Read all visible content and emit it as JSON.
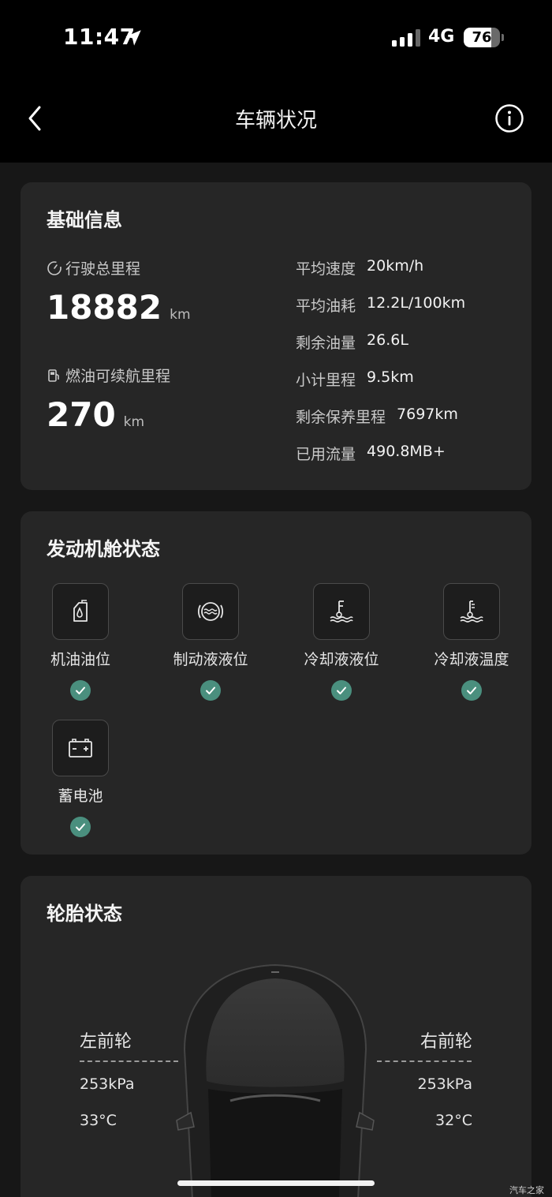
{
  "status": {
    "time": "11:47",
    "network": "4G",
    "battery": "76",
    "battery_level": 0.76
  },
  "nav": {
    "title": "车辆状况"
  },
  "basic": {
    "title": "基础信息",
    "total_mileage_label": "行驶总里程",
    "total_mileage": "18882",
    "total_mileage_unit": "km",
    "range_label": "燃油可续航里程",
    "range": "270",
    "range_unit": "km",
    "rows": [
      {
        "key": "平均速度",
        "value": "20km/h"
      },
      {
        "key": "平均油耗",
        "value": "12.2L/100km"
      },
      {
        "key": "剩余油量",
        "value": "26.6L"
      },
      {
        "key": "小计里程",
        "value": "9.5km"
      },
      {
        "key": "剩余保养里程",
        "value": "7697km"
      },
      {
        "key": "已用流量",
        "value": "490.8MB+"
      }
    ]
  },
  "engine": {
    "title": "发动机舱状态",
    "items": [
      {
        "label": "机油油位",
        "icon": "oil-level-icon",
        "status": "ok"
      },
      {
        "label": "制动液液位",
        "icon": "brake-fluid-icon",
        "status": "ok"
      },
      {
        "label": "冷却液液位",
        "icon": "coolant-level-icon",
        "status": "ok"
      },
      {
        "label": "冷却液温度",
        "icon": "coolant-temp-icon",
        "status": "ok"
      },
      {
        "label": "蓄电池",
        "icon": "battery-icon",
        "status": "ok"
      }
    ]
  },
  "tires": {
    "title": "轮胎状态",
    "front_left": {
      "label": "左前轮",
      "pressure": "253kPa",
      "temp": "33°C"
    },
    "front_right": {
      "label": "右前轮",
      "pressure": "253kPa",
      "temp": "32°C"
    }
  },
  "watermark": "汽车之家",
  "colors": {
    "background": "#171717",
    "card": "#262626",
    "check": "#4a8f7e",
    "bar": "#000000"
  }
}
